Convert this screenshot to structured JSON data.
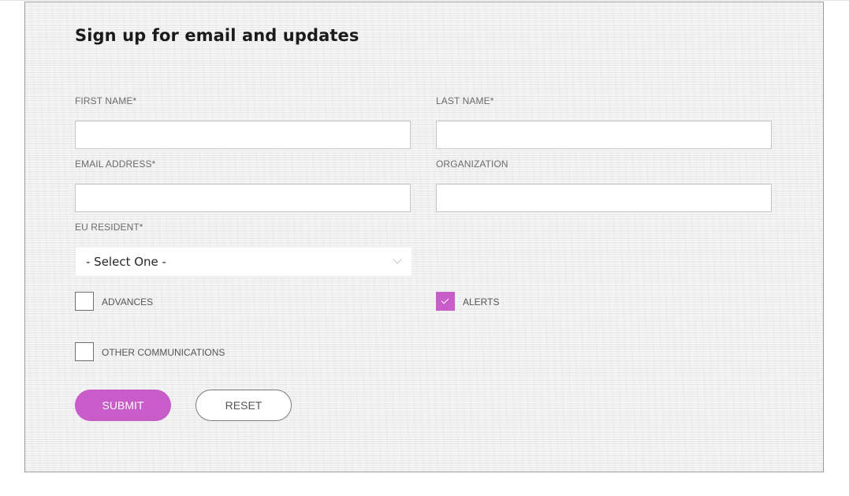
{
  "form": {
    "title": "Sign up for email and updates",
    "fields": {
      "first_name": {
        "label": "FIRST NAME*",
        "value": "",
        "placeholder": ""
      },
      "last_name": {
        "label": "LAST NAME*",
        "value": "",
        "placeholder": ""
      },
      "email": {
        "label": "EMAIL ADDRESS*",
        "value": "",
        "placeholder": ""
      },
      "organization": {
        "label": "ORGANIZATION",
        "value": "",
        "placeholder": ""
      },
      "eu_resident": {
        "label": "EU RESIDENT*",
        "selected": "- Select One -"
      }
    },
    "checkboxes": {
      "advances": {
        "label": "ADVANCES",
        "checked": false
      },
      "alerts": {
        "label": "ALERTS",
        "checked": true
      },
      "other": {
        "label": "OTHER COMMUNICATIONS",
        "checked": false
      }
    },
    "buttons": {
      "submit": "SUBMIT",
      "reset": "RESET"
    }
  },
  "colors": {
    "accent": "#c85cc8",
    "panel_background": "#efefef",
    "panel_border": "#9a9a9a"
  },
  "icons": {
    "select_arrow": "chevron-down-icon",
    "checkbox_check": "checkmark-icon"
  }
}
